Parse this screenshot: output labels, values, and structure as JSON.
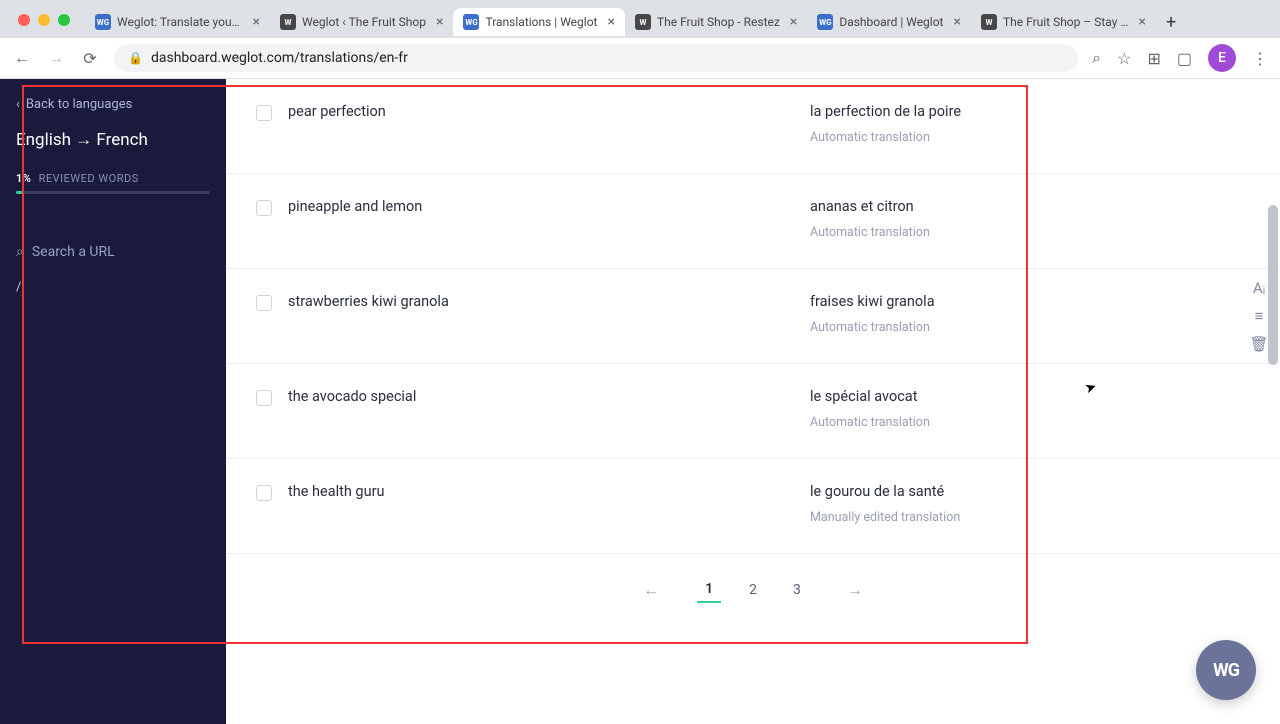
{
  "browser": {
    "tabs": [
      {
        "title": "Weglot: Translate your w",
        "favicon": "WG"
      },
      {
        "title": "Weglot ‹ The Fruit Shop",
        "favicon": "wp"
      },
      {
        "title": "Translations | Weglot",
        "favicon": "WG",
        "active": true
      },
      {
        "title": "The Fruit Shop - Restez",
        "favicon": "wp"
      },
      {
        "title": "Dashboard | Weglot",
        "favicon": "WG"
      },
      {
        "title": "The Fruit Shop – Stay He",
        "favicon": "wp"
      }
    ],
    "url": "dashboard.weglot.com/translations/en-fr",
    "avatar_initial": "E"
  },
  "sidebar": {
    "back_label": "Back to languages",
    "lang_pair": "English → French",
    "reviewed_pct": "1%",
    "reviewed_label": "REVIEWED WORDS",
    "search_placeholder": "Search a URL",
    "path": "/"
  },
  "rows": [
    {
      "src": "pear perfection",
      "tgt": "la perfection de la poire",
      "status": "Automatic translation"
    },
    {
      "src": "pineapple and lemon",
      "tgt": "ananas et citron",
      "status": "Automatic translation"
    },
    {
      "src": "strawberries kiwi granola",
      "tgt": "fraises kiwi granola",
      "status": "Automatic translation",
      "hover": true
    },
    {
      "src": "the avocado special",
      "tgt": "le spécial avocat",
      "status": "Automatic translation"
    },
    {
      "src": "the health guru",
      "tgt": "le gourou de la santé",
      "status": "Manually edited translation"
    }
  ],
  "pagination": {
    "pages": [
      "1",
      "2",
      "3"
    ],
    "active": "1"
  },
  "fab": "WG"
}
